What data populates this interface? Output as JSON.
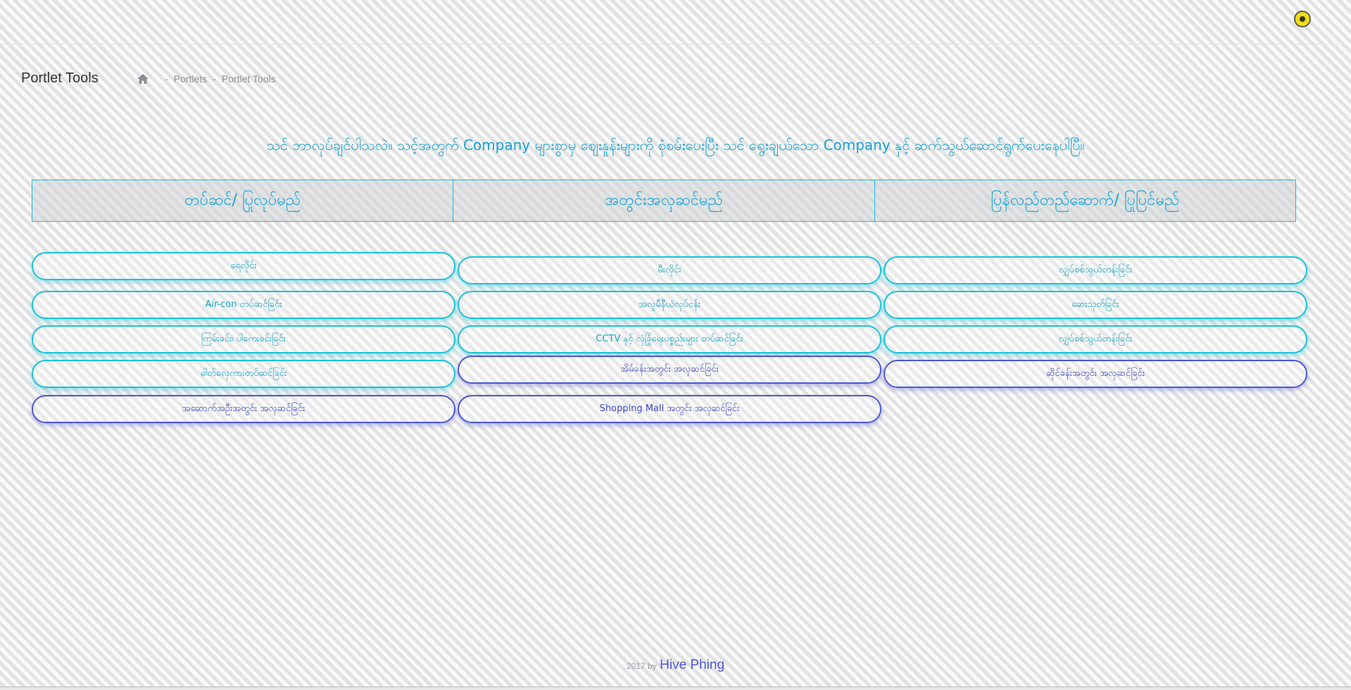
{
  "header": {
    "user_badge_icon": "user-avatar-icon"
  },
  "page": {
    "title": "Portlet Tools",
    "breadcrumb": {
      "home_icon": "home-icon",
      "separator": "-",
      "items": [
        "Portlets",
        "Portlet Tools"
      ]
    }
  },
  "intro": "သင် ဘာလုပ်ချင်ပါသလဲ။ သင့်အတွက် Company များစွာမှ စျေးနှုန်းများကို စုံစမ်းပေးပြီး သင် ရွေးချယ်သော Company နှင့် ဆက်သွယ်ဆောင်ရွက်ပေးနေပါပြီ။",
  "tabs": [
    {
      "label": "တပ်ဆင်/ ပြုလုပ်မည်"
    },
    {
      "label": "အတွင်းအလှဆင်မည်"
    },
    {
      "label": "ပြန်လည်တည်ဆောက်/ ပြုပြင်မည်"
    }
  ],
  "services": [
    {
      "label": "ရေလိုင်း",
      "style": "cyan"
    },
    {
      "label": "Air-con တပ်ဆင်ခြင်း",
      "style": "cyan"
    },
    {
      "label": "ကြမ်းခင်း၊ ပါကေးခင်းခြင်း",
      "style": "cyan"
    },
    {
      "label": "ဓါတ်လှေကားတပ်ဆင်ခြင်း",
      "style": "cyan"
    },
    {
      "label": "အဆောက်အဦးအတွင်း အလှဆင်ခြင်း",
      "style": "blue"
    },
    {
      "label": "မီးလိုင်း",
      "style": "cyan"
    },
    {
      "label": "အလူမီနီယံလုပ်ငန်း",
      "style": "cyan"
    },
    {
      "label": "CCTV နှင့် လုံခြုံရေးပစ္စည်းများ တပ်ဆင်ခြင်း",
      "style": "cyan"
    },
    {
      "label": "အိမ်ခန်းအတွင်း အလှဆင်ခြင်း",
      "style": "blue"
    },
    {
      "label": "Shopping Mall အတွင်း အလှဆင်ခြင်း",
      "style": "blue"
    },
    {
      "label": "လျှပ်စစ်သွယ်တန်းခြင်း",
      "style": "cyan"
    },
    {
      "label": "ဆေးသုတ်ခြင်း",
      "style": "cyan"
    },
    {
      "label": "လျှပ်စစ်သွယ်တန်းခြင်း",
      "style": "cyan"
    },
    {
      "label": "ဆိုင်ခန်းအတွင်း အလှဆင်ခြင်း",
      "style": "blue"
    }
  ],
  "footer": {
    "prefix": "2017 by",
    "brand": "Hive Phing"
  },
  "colors": {
    "accent_cyan": "#13a3d9",
    "pill_cyan": "#18c4dc",
    "pill_blue": "#4b57d8",
    "badge_yellow": "#f2de13"
  }
}
